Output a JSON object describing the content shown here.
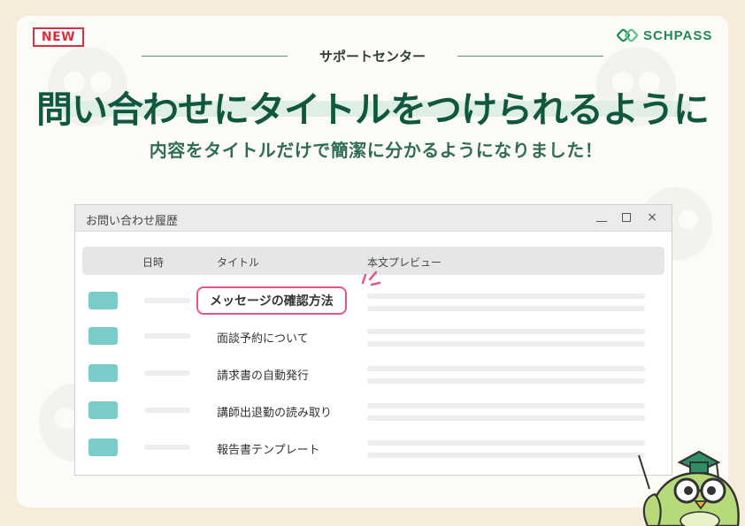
{
  "badge": {
    "label": "NEW"
  },
  "brand": {
    "name": "SCHPASS",
    "color": "#1e8a57"
  },
  "section_label": "サポートセンター",
  "headline": "問い合わせにタイトルをつけられるように",
  "subheadline": "内容をタイトルだけで簡潔に分かるようになりました！",
  "window": {
    "title": "お問い合わせ履歴",
    "controls": {
      "minimize": "_",
      "maximize": "☐",
      "close": "×"
    },
    "columns": {
      "date": "日時",
      "title": "タイトル",
      "preview": "本文プレビュー"
    },
    "rows": [
      {
        "title": "メッセージの確認方法",
        "highlighted": true
      },
      {
        "title": "面談予約について"
      },
      {
        "title": "請求書の自動発行"
      },
      {
        "title": "講師出退勤の読み取り"
      },
      {
        "title": "報告書テンプレート"
      }
    ]
  },
  "colors": {
    "headline": "#0f573f",
    "accent_pink": "#e8528e",
    "chip": "#79ccc8",
    "badge": "#d6313f"
  }
}
